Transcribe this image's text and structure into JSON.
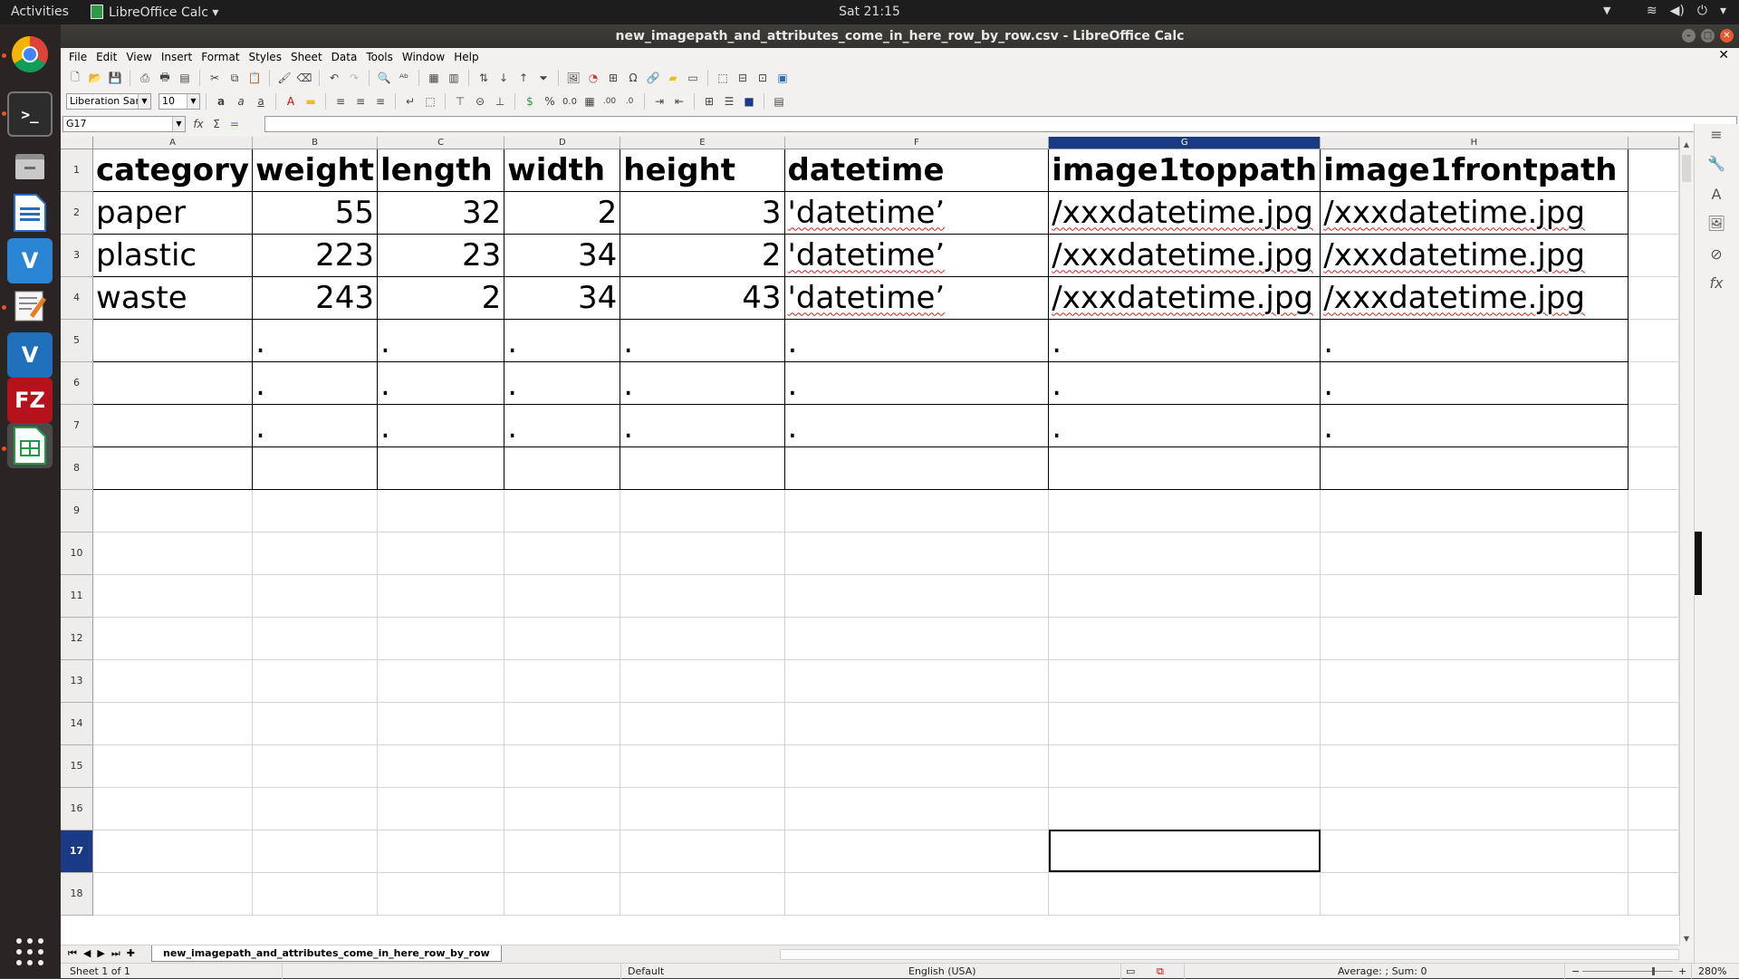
{
  "topbar": {
    "activities": "Activities",
    "app_name": "LibreOffice Calc",
    "clock": "Sat 21:15",
    "tray_icons": [
      "wifi-icon",
      "volume-icon",
      "power-icon"
    ]
  },
  "dock": {
    "items": [
      "chrome",
      "terminal",
      "files",
      "writer",
      "vscode",
      "text-editor",
      "vscode-insiders",
      "filezilla",
      "calc"
    ],
    "filezilla_label": "FZ",
    "vscode_label": "V",
    "calc_accent": "#1e9c45"
  },
  "window": {
    "title": "new_imagepath_and_attributes_come_in_here_row_by_row.csv - LibreOffice Calc"
  },
  "menu": [
    "File",
    "Edit",
    "View",
    "Insert",
    "Format",
    "Styles",
    "Sheet",
    "Data",
    "Tools",
    "Window",
    "Help"
  ],
  "formatting": {
    "font_name": "Liberation Sans",
    "font_size": "10"
  },
  "formula": {
    "cell_ref": "G17",
    "content": ""
  },
  "grid": {
    "columns": [
      "A",
      "B",
      "C",
      "D",
      "E",
      "F",
      "G",
      "H"
    ],
    "selected_column": "G",
    "rows": [
      "1",
      "2",
      "3",
      "4",
      "5",
      "6",
      "7",
      "8",
      "9",
      "10",
      "11",
      "12",
      "13",
      "14",
      "15",
      "16",
      "17",
      "18"
    ],
    "selected_row": "17",
    "cells": [
      [
        "category",
        "weight",
        "length",
        "width",
        "height",
        "datetime",
        "image1toppath",
        "image1frontpath"
      ],
      [
        "paper",
        "55",
        "32",
        "2",
        "3",
        "'datetime’",
        "/xxxdatetime.jpg",
        "/xxxdatetime.jpg"
      ],
      [
        "plastic",
        "223",
        "23",
        "34",
        "2",
        "'datetime’",
        "/xxxdatetime.jpg",
        "/xxxdatetime.jpg"
      ],
      [
        "waste",
        "243",
        "2",
        "34",
        "43",
        "'datetime’",
        "/xxxdatetime.jpg",
        "/xxxdatetime.jpg"
      ],
      [
        "",
        ".",
        ".",
        ".",
        ".",
        ".",
        ".",
        "."
      ],
      [
        "",
        ".",
        ".",
        ".",
        ".",
        ".",
        ".",
        "."
      ],
      [
        "",
        ".",
        ".",
        ".",
        ".",
        ".",
        ".",
        "."
      ],
      [
        "",
        "",
        "",
        "",
        "",
        "",
        "",
        ""
      ]
    ]
  },
  "sheet_tab": "new_imagepath_and_attributes_come_in_here_row_by_row",
  "status": {
    "sheet": "Sheet 1 of 1",
    "style": "Default",
    "language": "English (USA)",
    "summary": "Average: ; Sum: 0",
    "zoom": "280%"
  }
}
